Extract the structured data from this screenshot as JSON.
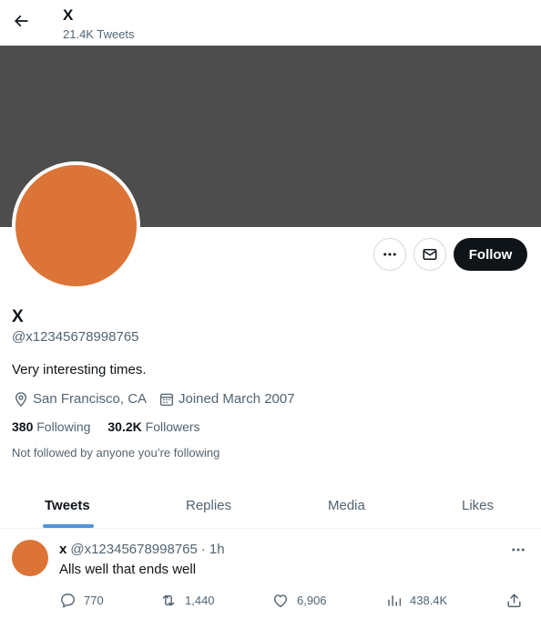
{
  "header": {
    "title": "X",
    "tweet_count": "21.4K Tweets"
  },
  "profile": {
    "name": "X",
    "handle": "@x12345678998765",
    "bio": "Very interesting times.",
    "location": "San Francisco, CA",
    "joined": "Joined March 2007",
    "following_count": "380",
    "following_label": "Following",
    "followers_count": "30.2K",
    "followers_label": "Followers",
    "not_followed": "Not followed by anyone you’re following",
    "avatar_color": "#db7436",
    "banner_color": "#4d4d4d"
  },
  "actions": {
    "follow_label": "Follow"
  },
  "tabs": [
    {
      "label": "Tweets",
      "active": true
    },
    {
      "label": "Replies",
      "active": false
    },
    {
      "label": "Media",
      "active": false
    },
    {
      "label": "Likes",
      "active": false
    }
  ],
  "tweet": {
    "name": "x",
    "handle": "@x12345678998765",
    "separator": "·",
    "time": "1h",
    "text": "Alls well that ends well",
    "replies": "770",
    "retweets": "1,440",
    "likes": "6,906",
    "views": "438.4K"
  },
  "colors": {
    "accent": "#4f94d9",
    "text": "#0f1419",
    "secondary_text": "#536471"
  }
}
